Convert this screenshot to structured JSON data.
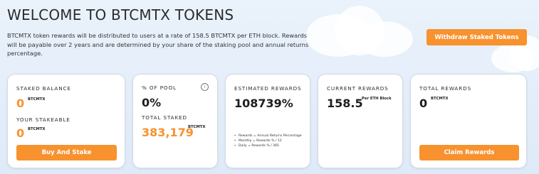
{
  "header": {
    "title": "WELCOME TO BTCMTX TOKENS",
    "description": "BTCMTX token rewards will be distributed to users at a rate of 158.5 BTCMTX per ETH block. Rewards will be payable over 2 years and are determined by your share of the staking pool and annual returns percentage.",
    "withdraw_label": "Withdraw Staked Tokens"
  },
  "staked": {
    "label": "STAKED BALANCE",
    "value": "0",
    "unit": "BTCMTX",
    "stakeable_label": "YOUR STAKEABLE",
    "stakeable_value": "0",
    "stakeable_unit": "BTCMTX",
    "button_label": "Buy And Stake"
  },
  "pool": {
    "label": "% OF POOL",
    "value": "0%",
    "info_icon": "info-icon",
    "total_label": "TOTAL STAKED",
    "total_value": "383,179",
    "total_unit": "BTCMTX"
  },
  "estimated": {
    "label": "ESTIMATED REWARDS",
    "value": "108739%",
    "notes": [
      "Rewards = Annual Returns Percentage",
      "Monthly = Rewards % / 12",
      "Daily = Rewards % / 365"
    ]
  },
  "current": {
    "label": "CURRENT REWARDS",
    "value": "158.5",
    "unit": "Per ETH Block"
  },
  "total": {
    "label": "TOTAL REWARDS",
    "value": "0",
    "unit": "BTCMTX",
    "button_label": "Claim Rewards"
  },
  "colors": {
    "accent": "#f7922f",
    "background": "#e3edf9",
    "card": "#ffffff"
  }
}
